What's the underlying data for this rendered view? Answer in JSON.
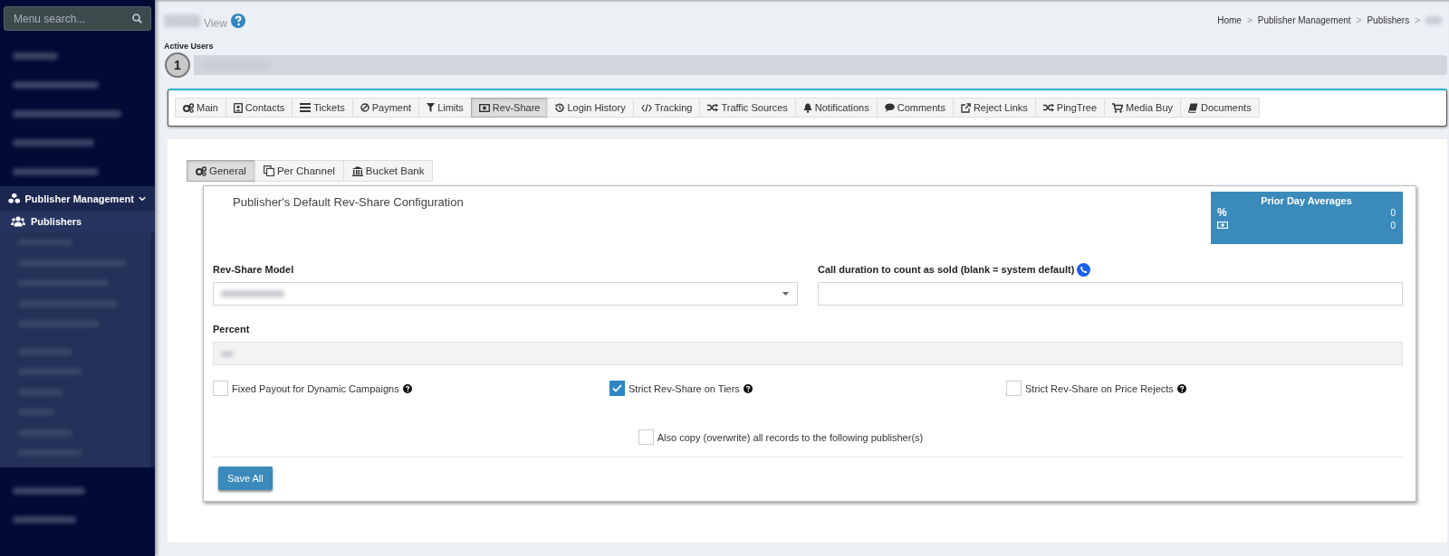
{
  "sidebar": {
    "search": {
      "placeholder": "Menu search..."
    },
    "items": [
      {
        "label": "Publisher Management",
        "expanded": true,
        "selected": false,
        "children": [
          {
            "label": "Publishers",
            "selected": true
          }
        ]
      }
    ]
  },
  "header": {
    "title_suffix": "View",
    "breadcrumb": [
      {
        "kind": "link",
        "text": "Home"
      },
      {
        "kind": "separator",
        "text": ">"
      },
      {
        "kind": "link",
        "text": "Publisher Management"
      },
      {
        "kind": "separator",
        "text": ">"
      },
      {
        "kind": "link",
        "text": "Publishers"
      },
      {
        "kind": "separator",
        "text": ">"
      }
    ]
  },
  "active_users": {
    "label": "Active Users",
    "count": "1"
  },
  "tabs": [
    {
      "label": "Main",
      "selected": false
    },
    {
      "label": "Contacts",
      "selected": false
    },
    {
      "label": "Tickets",
      "selected": false
    },
    {
      "label": "Payment",
      "selected": false
    },
    {
      "label": "Limits",
      "selected": false
    },
    {
      "label": "Rev-Share",
      "selected": true
    },
    {
      "label": "Login History",
      "selected": false
    },
    {
      "label": "Tracking",
      "selected": false
    },
    {
      "label": "Traffic Sources",
      "selected": false
    },
    {
      "label": "Notifications",
      "selected": false
    },
    {
      "label": "Comments",
      "selected": false
    },
    {
      "label": "Reject Links",
      "selected": false
    },
    {
      "label": "PingTree",
      "selected": false
    },
    {
      "label": "Media Buy",
      "selected": false
    },
    {
      "label": "Documents",
      "selected": false
    }
  ],
  "sub_tabs": [
    {
      "label": "General",
      "selected": true
    },
    {
      "label": "Per Channel",
      "selected": false
    },
    {
      "label": "Bucket Bank",
      "selected": false
    }
  ],
  "panel": {
    "title": "Publisher's Default Rev-Share Configuration",
    "averages": {
      "title": "Prior Day Averages",
      "rows": [
        {
          "symbol": "%",
          "value": "0"
        },
        {
          "value": "0"
        }
      ]
    },
    "rev_share_model": {
      "label": "Rev-Share Model"
    },
    "call_duration": {
      "label": "Call duration to count as sold (blank = system default)"
    },
    "percent": {
      "label": "Percent",
      "disabled": true
    },
    "checkboxes": [
      {
        "label": "Fixed Payout for Dynamic Campaigns",
        "checked": false,
        "help": true
      },
      {
        "label": "Strict Rev-Share on Tiers",
        "checked": true,
        "help": true
      },
      {
        "label": "Strict Rev-Share on Price Rejects",
        "checked": false,
        "help": true
      }
    ],
    "copy_option": {
      "label": "Also copy (overwrite) all records to the following publisher(s)",
      "checked": false
    },
    "save_button": "Save All"
  }
}
